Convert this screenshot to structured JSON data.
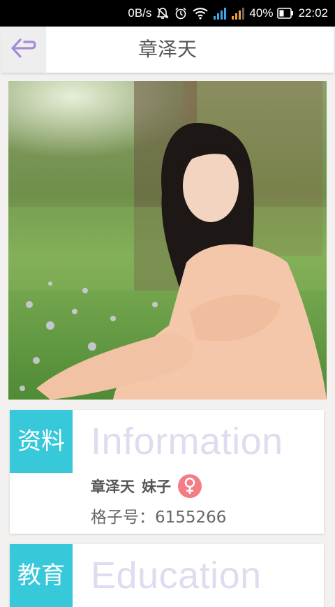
{
  "status_bar": {
    "speed": "0B/s",
    "battery": "40%",
    "time": "22:02",
    "icons": [
      "mute-bell-icon",
      "alarm-icon",
      "wifi-icon",
      "signal-icon",
      "signal-icon",
      "battery-icon"
    ]
  },
  "header": {
    "title": "章泽天",
    "back_icon": "back-arrow-icon",
    "accent": "#a88bd6"
  },
  "info_card": {
    "tag": "资料",
    "heading": "Information",
    "name": "章泽天",
    "relation": "妹子",
    "gender_icon": "female-icon",
    "id_label": "格子号：",
    "id_value": "6155266",
    "tag_color": "#37c8d9",
    "badge_color": "#f47c85"
  },
  "edu_card": {
    "tag": "教育",
    "heading": "Education"
  }
}
